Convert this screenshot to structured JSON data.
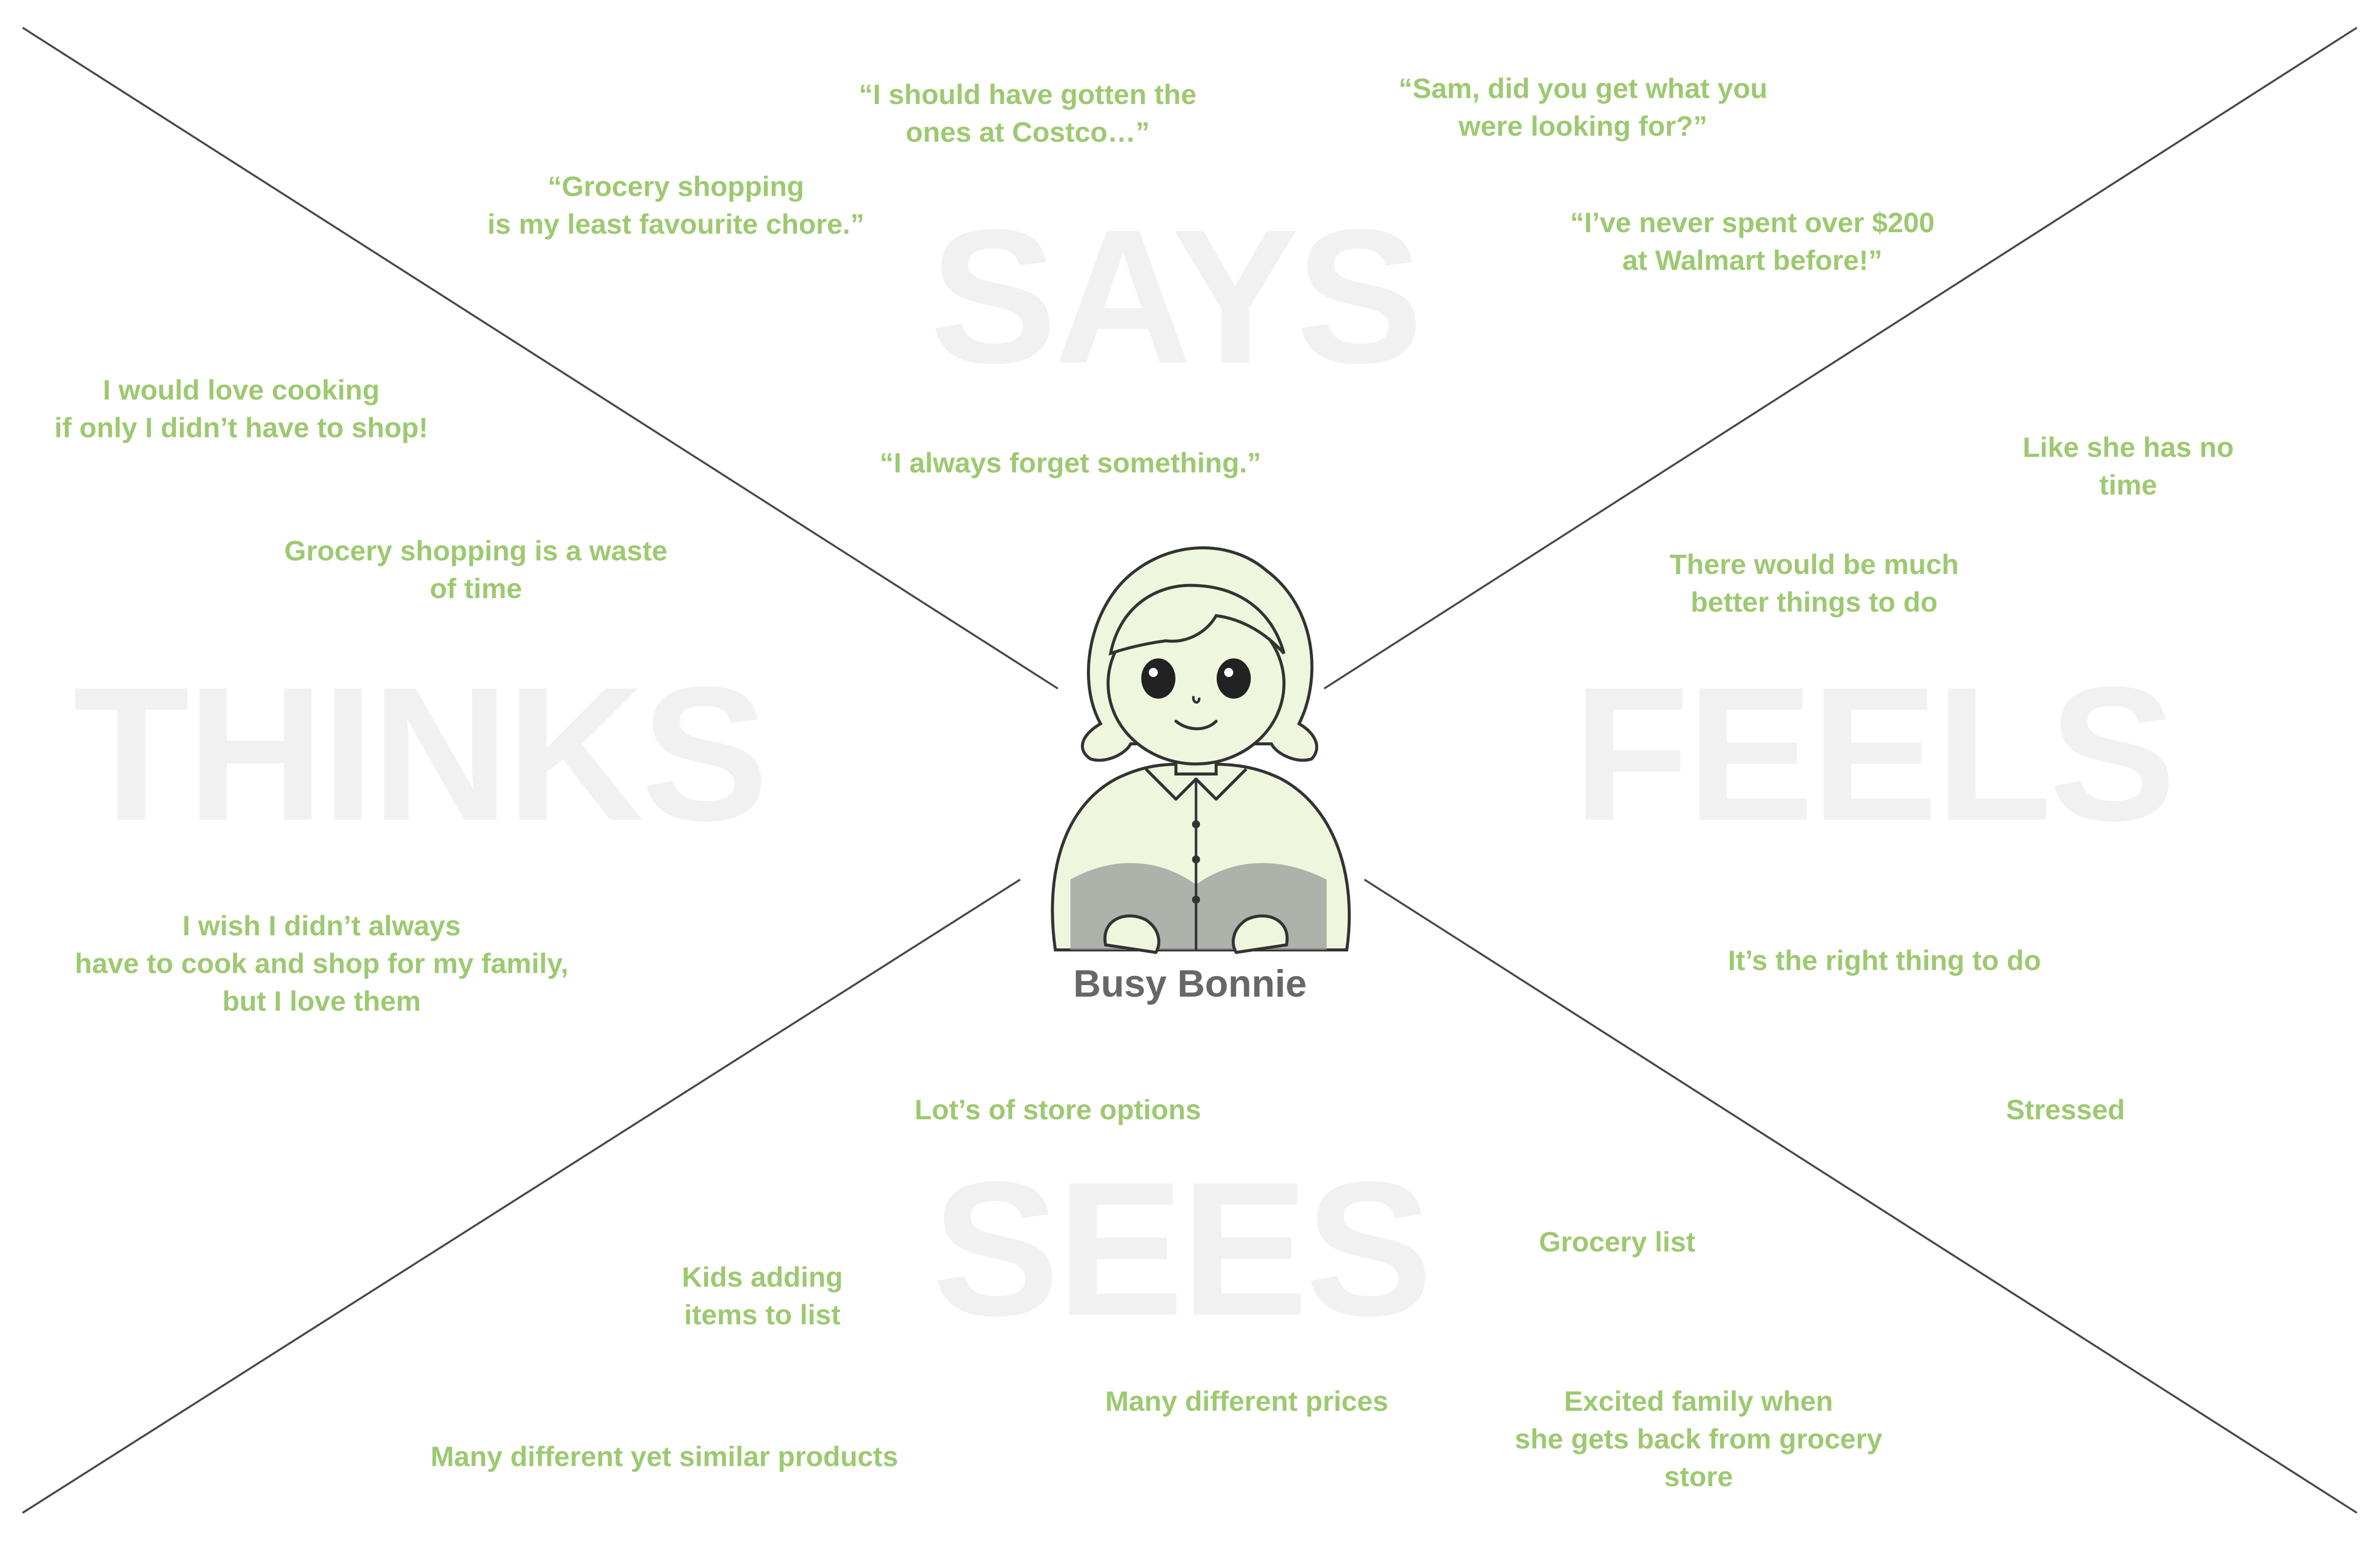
{
  "quadrants": {
    "says": "SAYS",
    "thinks": "THINKS",
    "feels": "FEELS",
    "sees": "SEES"
  },
  "persona": {
    "name": "Busy Bonnie",
    "illustration": "woman-with-cardigan-portrait"
  },
  "notes": {
    "says": [
      "“I should have gotten the\nones at Costco…”",
      "“Sam, did you get what you\nwere looking for?”",
      "“Grocery shopping\nis my least favourite chore.”",
      "“I’ve never spent over $200\nat Walmart before!”",
      "“I always forget something.”"
    ],
    "thinks": [
      "I would love cooking\nif only I didn’t have to shop!",
      "Grocery shopping is a waste\nof time",
      "I wish I didn’t always\nhave to cook and shop for my family,\nbut I love them"
    ],
    "feels": [
      "Like she has no time",
      "There would be much\nbetter things to do",
      "It’s the right thing to do",
      "Stressed"
    ],
    "sees": [
      "Lot’s of store options",
      "Kids adding\nitems to list",
      "Grocery list",
      "Many different prices",
      "Many different yet similar products",
      "Excited family when\nshe gets back from grocery\nstore"
    ]
  },
  "colors": {
    "note_text": "#9dc970",
    "quadrant_label": "#f1f1f1",
    "divider_lines": "#4a4a4a",
    "persona_name": "#676767",
    "skin_fill": "#eef6de"
  }
}
